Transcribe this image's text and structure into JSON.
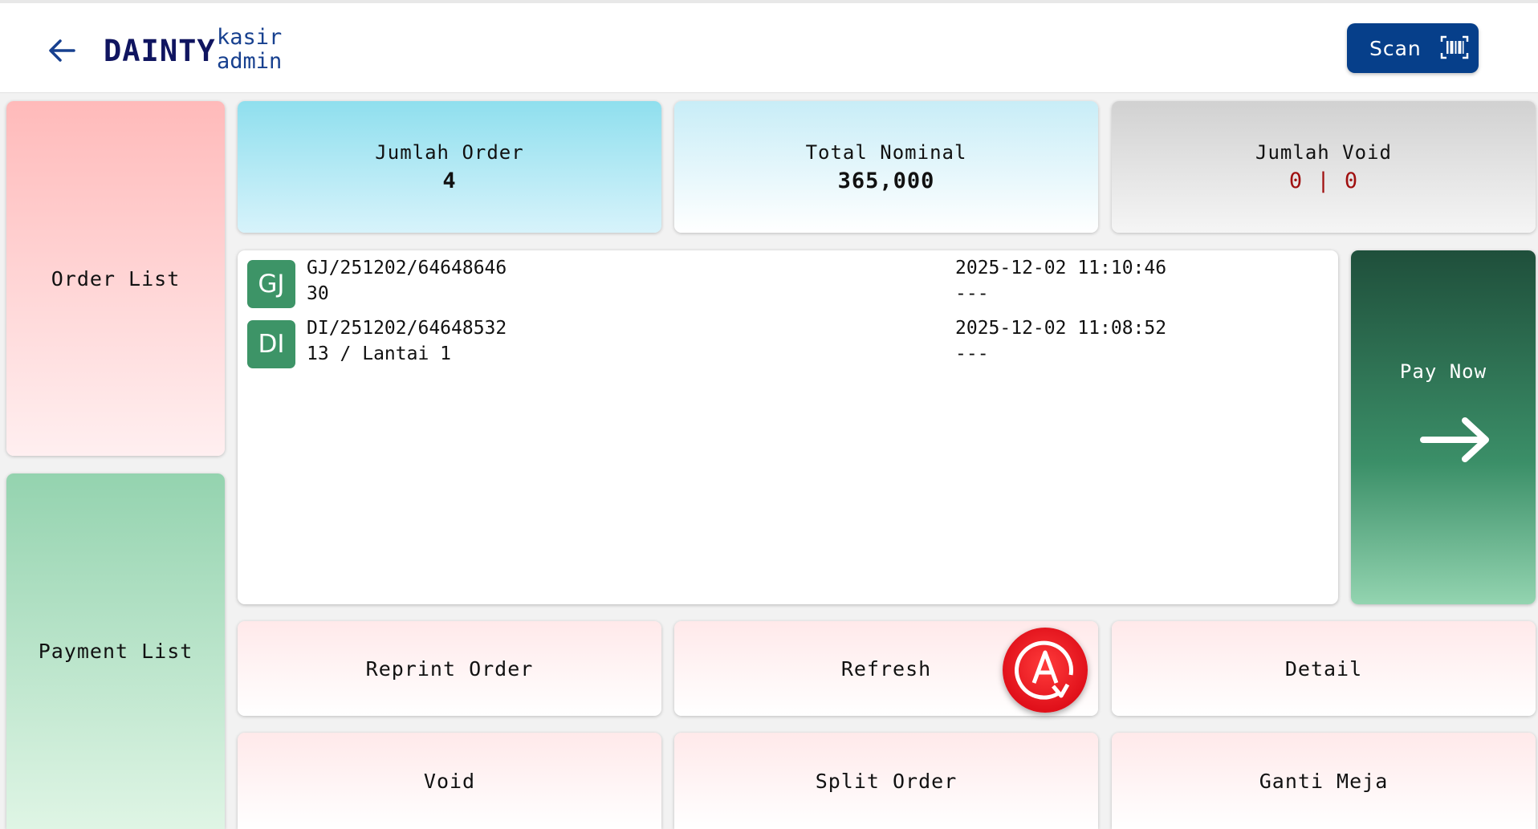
{
  "header": {
    "brand": "DAINTY",
    "role_line1": "kasir",
    "role_line2": "admin",
    "scan_label": "Scan"
  },
  "sidebar": {
    "order_list": "Order List",
    "payment_list": "Payment List"
  },
  "stats": {
    "order_label": "Jumlah Order",
    "order_value": "4",
    "nominal_label": "Total Nominal",
    "nominal_value": "365,000",
    "void_label": "Jumlah Void",
    "void_value": "0 | 0"
  },
  "orders": [
    {
      "badge": "GJ",
      "code": "GJ/251202/64648646",
      "table": "30",
      "time": "2025-12-02 11:10:46",
      "note": "---"
    },
    {
      "badge": "DI",
      "code": "DI/251202/64648532",
      "table": "13 / Lantai 1",
      "time": "2025-12-02 11:08:52",
      "note": "---"
    }
  ],
  "pay_now": "Pay Now",
  "actions": {
    "reprint": "Reprint Order",
    "refresh": "Refresh",
    "detail": "Detail",
    "void": "Void",
    "split": "Split Order",
    "ganti_meja": "Ganti Meja"
  },
  "colors": {
    "brand": "#101560",
    "scan_button": "#063f8a",
    "badge": "#3d9467",
    "void_value": "#a01010",
    "fab": "#e0101a"
  },
  "icons": {
    "back": "arrow-left-icon",
    "scan": "barcode-icon",
    "pay_now": "arrow-right-icon",
    "fab": "auto-rotate-icon"
  }
}
